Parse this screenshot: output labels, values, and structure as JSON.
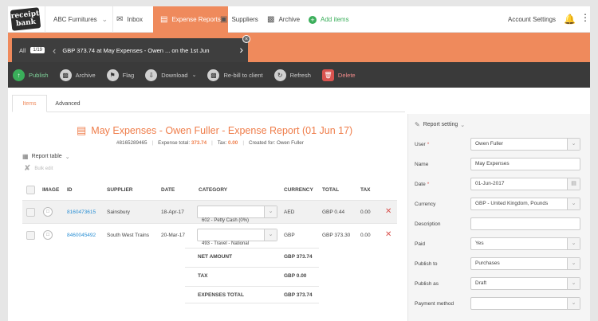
{
  "logo": {
    "line1": "receipt",
    "line2": "bank"
  },
  "org": {
    "name": "ABC Furnitures"
  },
  "nav": {
    "inbox": "Inbox",
    "expense_reports": "Expense Reports",
    "suppliers": "Suppliers",
    "archive": "Archive",
    "add_items": "Add items",
    "account_settings": "Account Settings"
  },
  "carousel": {
    "all": "All",
    "count": "1/19",
    "title": "GBP 373.74 at May Expenses - Owen ... on the 1st Jun"
  },
  "toolbar": {
    "publish": "Publish",
    "archive": "Archive",
    "flag": "Flag",
    "download": "Download",
    "rebill": "Re-bill to client",
    "refresh": "Refresh",
    "delete": "Delete"
  },
  "tabs": {
    "items": "Items",
    "advanced": "Advanced"
  },
  "report": {
    "title": "May Expenses - Owen Fuller - Expense Report (01 Jun 17)",
    "number": "#8165289465",
    "total_label": "Expense total:",
    "total_value": "373.74",
    "tax_label": "Tax:",
    "tax_value": "0.00",
    "created_label": "Created for: Owen Fuller"
  },
  "table": {
    "label": "Report table",
    "bulk_edit": "Bulk edit",
    "headers": {
      "image": "IMAGE",
      "id": "ID",
      "supplier": "SUPPLIER",
      "date": "DATE",
      "category": "CATEGORY",
      "currency": "CURRENCY",
      "total": "TOTAL",
      "tax": "TAX"
    },
    "rows": [
      {
        "id": "8160473615",
        "supplier": "Sainsbury",
        "date": "18-Apr-17",
        "category": "602 - Petty Cash (0%)",
        "currency": "AED",
        "total": "GBP 0.44",
        "tax": "0.00"
      },
      {
        "id": "8460045492",
        "supplier": "South West Trains",
        "date": "20-Mar-17",
        "category": "493 - Travel - National",
        "currency": "GBP",
        "total": "GBP 373.30",
        "tax": "0.00"
      }
    ],
    "totals": [
      {
        "label": "NET AMOUNT",
        "value": "GBP 373.74"
      },
      {
        "label": "TAX",
        "value": "GBP 0.00"
      },
      {
        "label": "EXPENSES TOTAL",
        "value": "GBP 373.74"
      }
    ]
  },
  "settings": {
    "title": "Report setting",
    "fields": [
      {
        "label": "User",
        "value": "Owen Fuller",
        "required": "*"
      },
      {
        "label": "Name",
        "value": "May Expenses",
        "required": ""
      },
      {
        "label": "Date",
        "value": "01-Jun-2017",
        "required": "*"
      },
      {
        "label": "Currency",
        "value": "GBP - United Kingdom, Pounds",
        "required": ""
      },
      {
        "label": "Description",
        "value": "",
        "required": ""
      },
      {
        "label": "Paid",
        "value": "Yes",
        "required": ""
      },
      {
        "label": "Publish to",
        "value": "Purchases",
        "required": ""
      },
      {
        "label": "Publish as",
        "value": "Draft",
        "required": ""
      },
      {
        "label": "Payment method",
        "value": "",
        "required": ""
      }
    ]
  },
  "colors": {
    "accent": "#ef8a5c",
    "title": "#ef7d4a",
    "green": "#3aae5a",
    "red": "#d9534f",
    "link": "#2a8fd4",
    "toolbar": "#3a3a3a"
  }
}
